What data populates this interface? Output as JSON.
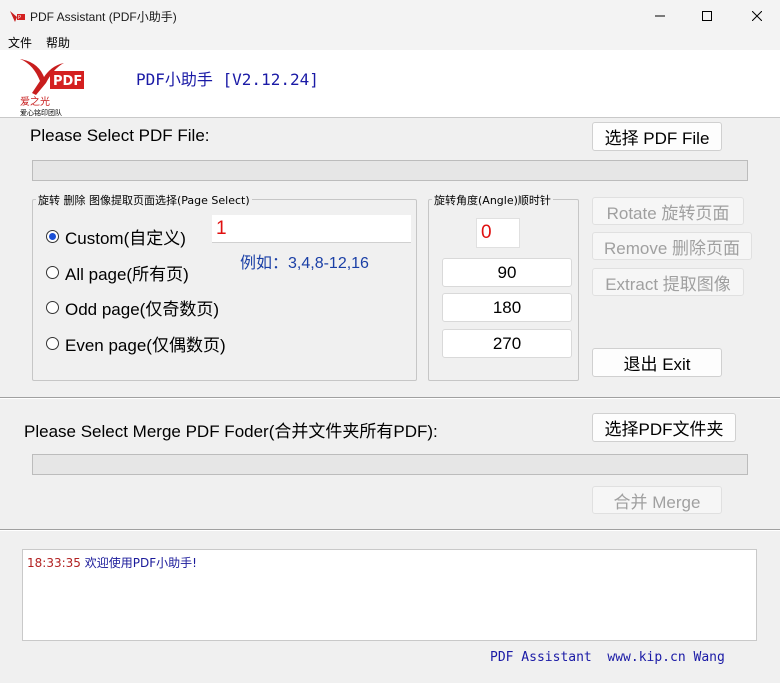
{
  "window": {
    "title": "PDF Assistant (PDF小助手)"
  },
  "menu": {
    "items": [
      "文件",
      "帮助"
    ]
  },
  "header": {
    "logo_text": "PDF",
    "logo_caption": "爱之光",
    "logo_subcaption": "爱心铭印团队",
    "heading": "PDF小助手 [V2.12.24]"
  },
  "select_file": {
    "label": "Please Select PDF File:",
    "button": "选择 PDF File",
    "progress": 0
  },
  "page_select": {
    "group_title": "旋转 删除 图像提取页面选择(Page Select)",
    "options": [
      {
        "label": "Custom(自定义)",
        "checked": true
      },
      {
        "label": "All page(所有页)",
        "checked": false
      },
      {
        "label": "Odd page(仅奇数页)",
        "checked": false
      },
      {
        "label": "Even page(仅偶数页)",
        "checked": false
      }
    ],
    "custom_value": "1",
    "example": "例如：3,4,8-12,16"
  },
  "angle": {
    "group_title": "旋转角度(Angle)顺时针",
    "current_value": "0",
    "options": [
      "90",
      "180",
      "270"
    ]
  },
  "actions": {
    "rotate": "Rotate  旋转页面",
    "remove": "Remove 删除页面",
    "extract": "Extract  提取图像",
    "exit": "退出 Exit"
  },
  "merge": {
    "label": "Please Select Merge PDF Foder(合并文件夹所有PDF):",
    "button": "选择PDF文件夹",
    "merge_button": "合并 Merge",
    "progress": 0
  },
  "log": {
    "entries": [
      {
        "time": "18:33:35",
        "message": " 欢迎使用PDF小助手!"
      }
    ]
  },
  "footer": {
    "text": "PDF Assistant  www.kip.cn Wang"
  },
  "colors": {
    "accent_blue": "#1a1aa6",
    "input_red": "#e01010",
    "log_time_red": "#b22222"
  }
}
